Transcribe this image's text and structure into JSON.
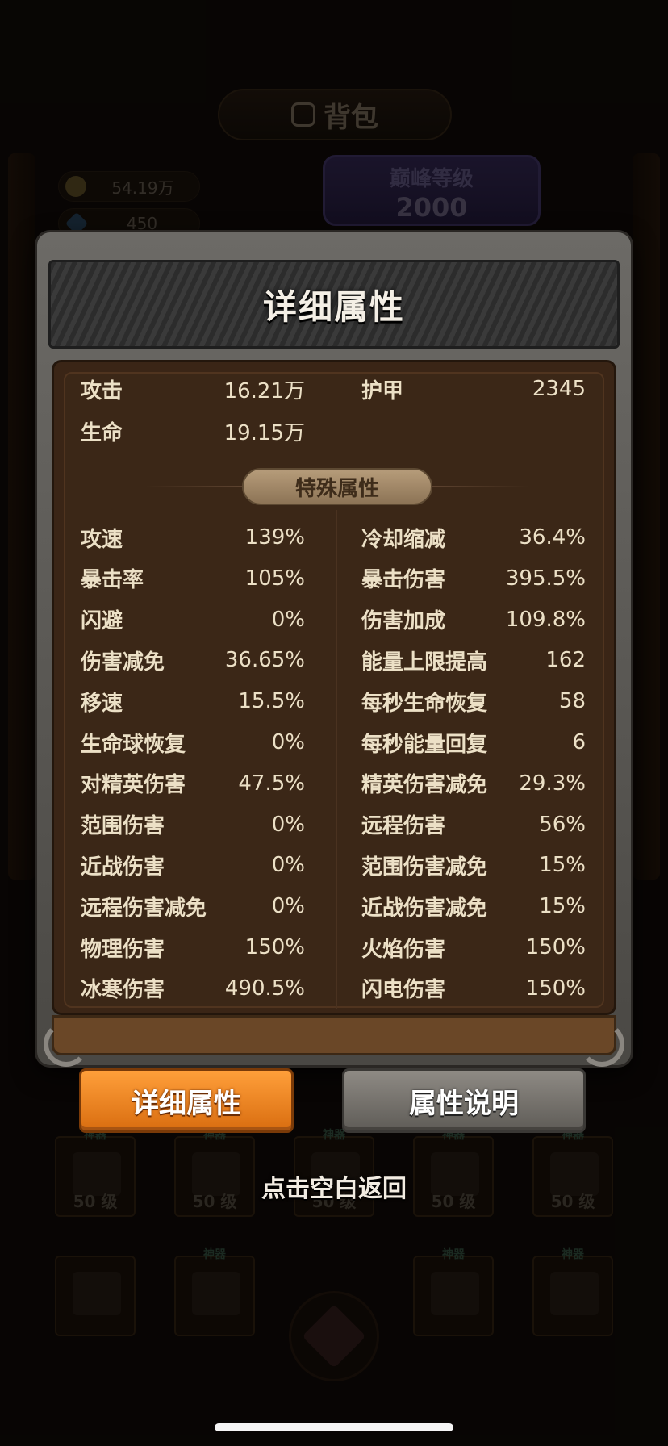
{
  "background": {
    "title": "背包",
    "currencies": [
      {
        "icon": "coin-icon",
        "value": "54.19万"
      },
      {
        "icon": "gem-icon",
        "value": "450"
      }
    ],
    "peak_level": {
      "label": "巅峰等级",
      "value": "2000"
    },
    "item_level_label": "50 级",
    "item_tag": "神器"
  },
  "modal": {
    "title": "详细属性",
    "base_stats": [
      {
        "label": "攻击",
        "value": "16.21万"
      },
      {
        "label": "护甲",
        "value": "2345"
      },
      {
        "label": "生命",
        "value": "19.15万"
      }
    ],
    "special_section_title": "特殊属性",
    "special_left": [
      {
        "label": "攻速",
        "value": "139%"
      },
      {
        "label": "暴击率",
        "value": "105%"
      },
      {
        "label": "闪避",
        "value": "0%"
      },
      {
        "label": "伤害减免",
        "value": "36.65%"
      },
      {
        "label": "移速",
        "value": "15.5%"
      },
      {
        "label": "生命球恢复",
        "value": "0%"
      },
      {
        "label": "对精英伤害",
        "value": "47.5%"
      },
      {
        "label": "范围伤害",
        "value": "0%"
      },
      {
        "label": "近战伤害",
        "value": "0%"
      },
      {
        "label": "远程伤害减免",
        "value": "0%"
      },
      {
        "label": "物理伤害",
        "value": "150%"
      },
      {
        "label": "冰寒伤害",
        "value": "490.5%"
      }
    ],
    "special_right": [
      {
        "label": "冷却缩减",
        "value": "36.4%"
      },
      {
        "label": "暴击伤害",
        "value": "395.5%"
      },
      {
        "label": "伤害加成",
        "value": "109.8%"
      },
      {
        "label": "能量上限提高",
        "value": "162"
      },
      {
        "label": "每秒生命恢复",
        "value": "58"
      },
      {
        "label": "每秒能量回复",
        "value": "6"
      },
      {
        "label": "精英伤害减免",
        "value": "29.3%"
      },
      {
        "label": "远程伤害",
        "value": "56%"
      },
      {
        "label": "范围伤害减免",
        "value": "15%"
      },
      {
        "label": "近战伤害减免",
        "value": "15%"
      },
      {
        "label": "火焰伤害",
        "value": "150%"
      },
      {
        "label": "闪电伤害",
        "value": "150%"
      }
    ]
  },
  "tabs": [
    {
      "label": "详细属性",
      "active": true
    },
    {
      "label": "属性说明",
      "active": false
    }
  ],
  "hint": "点击空白返回",
  "colors": {
    "panel_bg": "#3b2717",
    "tab_active": "#f08a24",
    "tab_inactive": "#7a7670",
    "stat_text": "#ece0c6"
  }
}
